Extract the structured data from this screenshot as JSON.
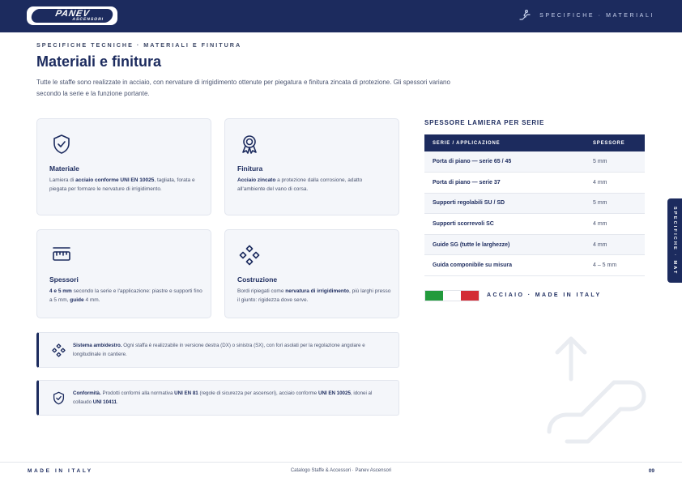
{
  "header": {
    "logo_text": "PANEV",
    "logo_sub": "ASCENSORI",
    "section_label": "SPECIFICHE · MATERIALI"
  },
  "eyebrow": "SPECIFICHE TECNICHE · MATERIALI E FINITURA",
  "title": "Materiali e finitura",
  "intro": "Tutte le staffe sono realizzate in acciaio, con nervature di irrigidimento ottenute per piegatura e finitura zincata di protezione. Gli spessori variano secondo la serie e la funzione portante.",
  "cards": [
    {
      "icon": "shield-check-icon",
      "title": "Materiale",
      "desc_pre": "Lamiera di ",
      "desc_bold": "acciaio conforme UNI EN 10025",
      "desc_post": ", tagliata, forata e piegata per formare le nervature di irrigidimento."
    },
    {
      "icon": "award-ribbon-icon",
      "title": "Finitura",
      "desc_pre": "",
      "desc_bold": "Acciaio zincato",
      "desc_post": " a protezione dalla corrosione, adatto all'ambiente del vano di corsa."
    },
    {
      "icon": "ruler-icon",
      "title": "Spessori",
      "desc_bold1": "4 e 5 mm",
      "desc_mid": " secondo la serie e l'applicazione: piastre e supporti fino a 5 mm, ",
      "desc_bold2": "guide",
      "desc_post": " 4 mm."
    },
    {
      "icon": "diamond-nodes-icon",
      "title": "Costruzione",
      "desc_pre": "Bordi ripiegati come ",
      "desc_bold": "nervatura di irrigidimento",
      "desc_post": ", più larghi presso il giunto: rigidezza dove serve."
    }
  ],
  "callouts": [
    {
      "icon": "diamond-nodes-icon",
      "bold": "Sistema ambidestro.",
      "text": " Ogni staffa è realizzabile in versione destra (DX) o sinistra (SX), con fori asolati per la regolazione angolare e longitudinale in cantiere."
    },
    {
      "icon": "shield-check-icon",
      "bold": "Conformità.",
      "text_pre": " Prodotti conformi alla normativa ",
      "bold2": "UNI EN 81",
      "text_mid": " (regole di sicurezza per ascensori), acciaio conforme ",
      "bold3": "UNI EN 10025",
      "text_mid2": ", idonei al collaudo ",
      "bold4": "UNI 10411",
      "text_post": "."
    }
  ],
  "table": {
    "title": "SPESSORE LAMIERA PER SERIE",
    "headers": [
      "SERIE / APPLICAZIONE",
      "SPESSORE"
    ],
    "rows": [
      [
        "Porta di piano — serie 65 / 45",
        "5 mm"
      ],
      [
        "Porta di piano — serie 37",
        "4 mm"
      ],
      [
        "Supporti regolabili SU / SD",
        "5 mm"
      ],
      [
        "Supporti scorrevoli SC",
        "4 mm"
      ],
      [
        "Guide SG (tutte le larghezze)",
        "4 mm"
      ],
      [
        "Guida componibile su misura",
        "4 – 5 mm"
      ]
    ]
  },
  "origin": {
    "label": "ACCIAIO · MADE IN ITALY",
    "flag_colors": [
      "#229a3c",
      "#ffffff",
      "#d32d36"
    ]
  },
  "sidetab": "SPECIFICHE · MAT",
  "footer": {
    "left": "MADE IN ITALY",
    "center": "Catalogo Staffe & Accessori · Panev Ascensori",
    "page": "09"
  },
  "colors": {
    "brand_navy": "#1c2b5e",
    "card_bg": "#f4f6fa"
  }
}
